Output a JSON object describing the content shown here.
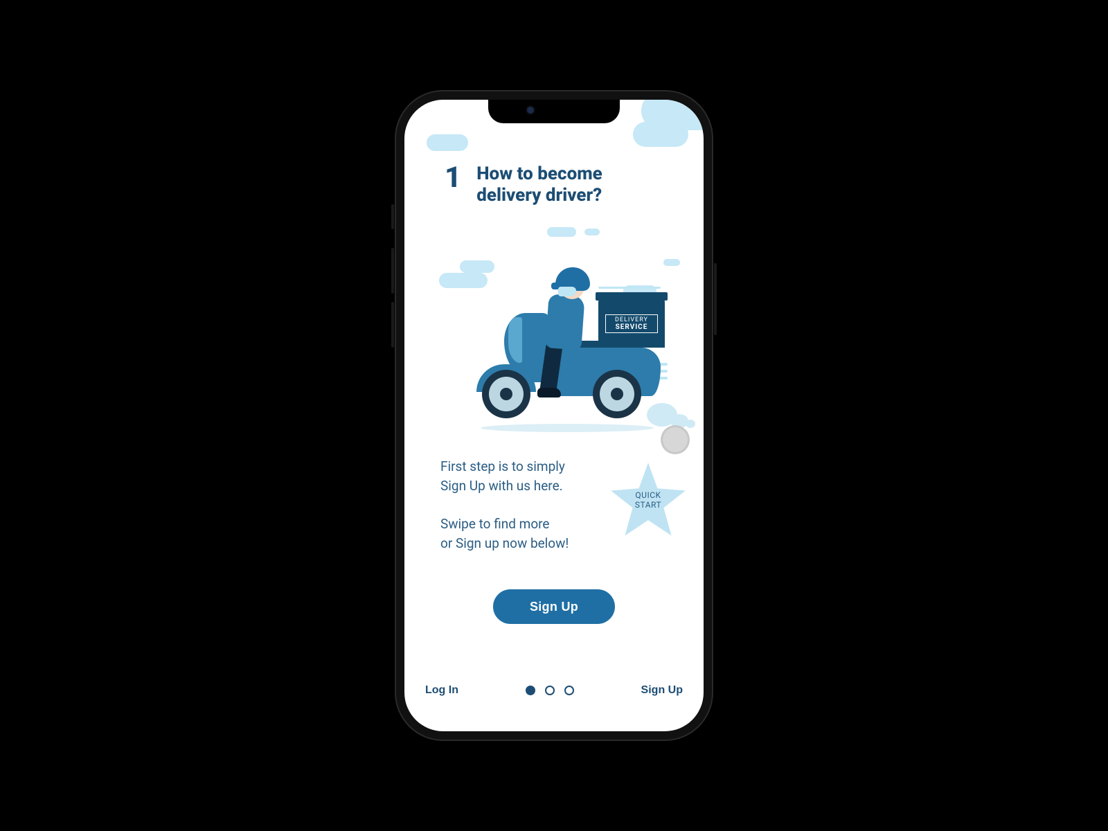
{
  "step_number": "1",
  "title_line1": "How to become",
  "title_line2": "delivery driver?",
  "delivery_box": {
    "line1": "DELIVERY",
    "line2": "SERVICE"
  },
  "body": {
    "line1": "First step is to simply",
    "line2": "Sign Up with us here.",
    "line3": "Swipe to find more",
    "line4": "or Sign up now below!"
  },
  "star": {
    "line1": "QUICK",
    "line2": "START"
  },
  "primary_button": "Sign Up",
  "footer": {
    "left": "Log In",
    "right": "Sign Up",
    "page_count": 3,
    "active_page": 1
  },
  "colors": {
    "brand": "#1f6fa5",
    "heading": "#1c4d74",
    "cloud": "#c6e8f7"
  }
}
